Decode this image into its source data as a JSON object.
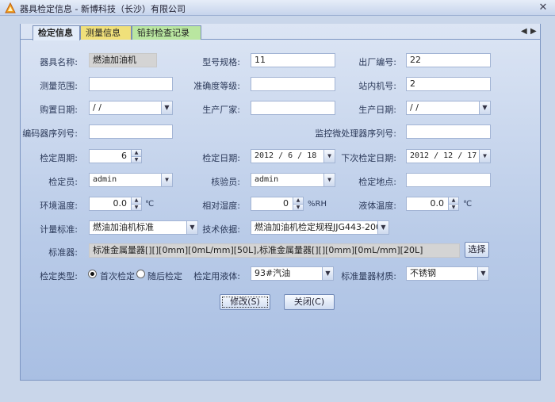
{
  "window": {
    "title": "器具检定信息 - 新博科技（长沙）有限公司",
    "close": "✕"
  },
  "tabs": [
    "检定信息",
    "测量信息",
    "铅封检查记录"
  ],
  "tab_scroll": {
    "left": "◀",
    "right": "▶"
  },
  "form": {
    "name": {
      "label": "器具名称:",
      "value": "燃油加油机"
    },
    "model": {
      "label": "型号规格:",
      "value": "11"
    },
    "serial": {
      "label": "出厂编号:",
      "value": "22"
    },
    "range": {
      "label": "测量范围:",
      "value": ""
    },
    "accuracy": {
      "label": "准确度等级:",
      "value": ""
    },
    "station_no": {
      "label": "站内机号:",
      "value": "2"
    },
    "purchase_date": {
      "label": "购置日期:",
      "value": " /  /"
    },
    "manufacturer": {
      "label": "生产厂家:",
      "value": ""
    },
    "production_date": {
      "label": "生产日期:",
      "value": " /  /"
    },
    "encoder_serial": {
      "label": "编码器序列号:",
      "value": ""
    },
    "mcu_serial": {
      "label": "监控微处理器序列号:",
      "value": ""
    },
    "period": {
      "label": "检定周期:",
      "value": "6"
    },
    "verify_date": {
      "label": "检定日期:",
      "value": "2012 / 6 / 18"
    },
    "next_date": {
      "label": "下次检定日期:",
      "value": "2012 / 12 / 17"
    },
    "inspector": {
      "label": "检定员:",
      "value": "admin"
    },
    "checker": {
      "label": "核验员:",
      "value": "admin"
    },
    "location": {
      "label": "检定地点:",
      "value": ""
    },
    "env_temp": {
      "label": "环境温度:",
      "value": "0.0",
      "unit": "℃"
    },
    "humidity": {
      "label": "相对湿度:",
      "value": "0",
      "unit": "%RH"
    },
    "liquid_temp": {
      "label": "液体温度:",
      "value": "0.0",
      "unit": "℃"
    },
    "standard": {
      "label": "计量标准:",
      "value": "燃油加油机标准"
    },
    "basis": {
      "label": "技术依据:",
      "value": "燃油加油机检定规程JJG443-200"
    },
    "std_devices": {
      "label": "标准器:",
      "value": "标准金属量器[][][0mm][0mL/mm][50L],标准金属量器[][][0mm][0mL/mm][20L]",
      "button": "选择"
    },
    "verify_type": {
      "label": "检定类型:",
      "options": [
        "首次检定",
        "随后检定"
      ],
      "selected": 0
    },
    "liquid": {
      "label": "检定用液体:",
      "value": "93#汽油"
    },
    "material": {
      "label": "标准量器材质:",
      "value": "不锈钢"
    }
  },
  "buttons": {
    "modify": "修改(S)",
    "close": "关闭(C)"
  }
}
